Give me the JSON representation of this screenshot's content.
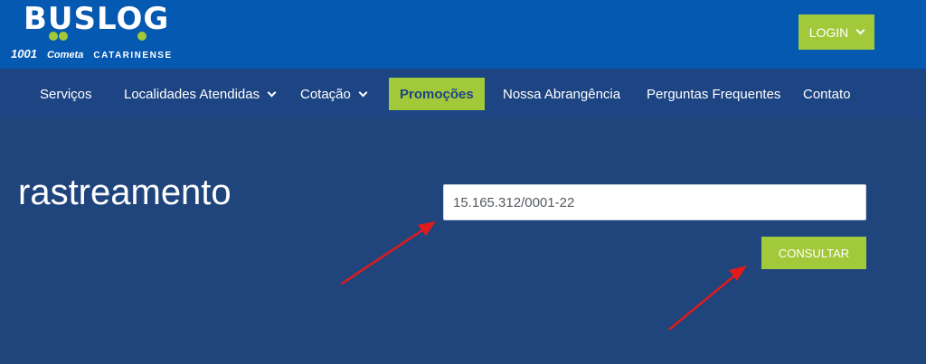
{
  "header": {
    "logo": {
      "wordmark": "BUSLOG",
      "brands": [
        "1001",
        "Cometa",
        "CATARINENSE"
      ]
    },
    "login_label": "LOGIN"
  },
  "nav": {
    "items": [
      {
        "label": "Serviços",
        "has_dropdown": false
      },
      {
        "label": "Localidades Atendidas",
        "has_dropdown": true
      },
      {
        "label": "Cotação",
        "has_dropdown": true
      },
      {
        "label": "Promoções",
        "active": true
      },
      {
        "label": "Nossa Abrangência"
      },
      {
        "label": "Perguntas Frequentes"
      },
      {
        "label": "Contato"
      }
    ]
  },
  "main": {
    "title": "rastreamento",
    "search": {
      "value": "15.165.312/0001-22",
      "placeholder": ""
    },
    "consult_label": "CONSULTAR"
  },
  "icons": {
    "dropdown": "chevron-down-icon",
    "annotation": "red-arrow-icon"
  },
  "colors": {
    "header_bg": "#0559b0",
    "nav_bg": "#1d4584",
    "main_bg": "#20447c",
    "accent": "#a2c93a",
    "annotation": "#e01b1b"
  }
}
